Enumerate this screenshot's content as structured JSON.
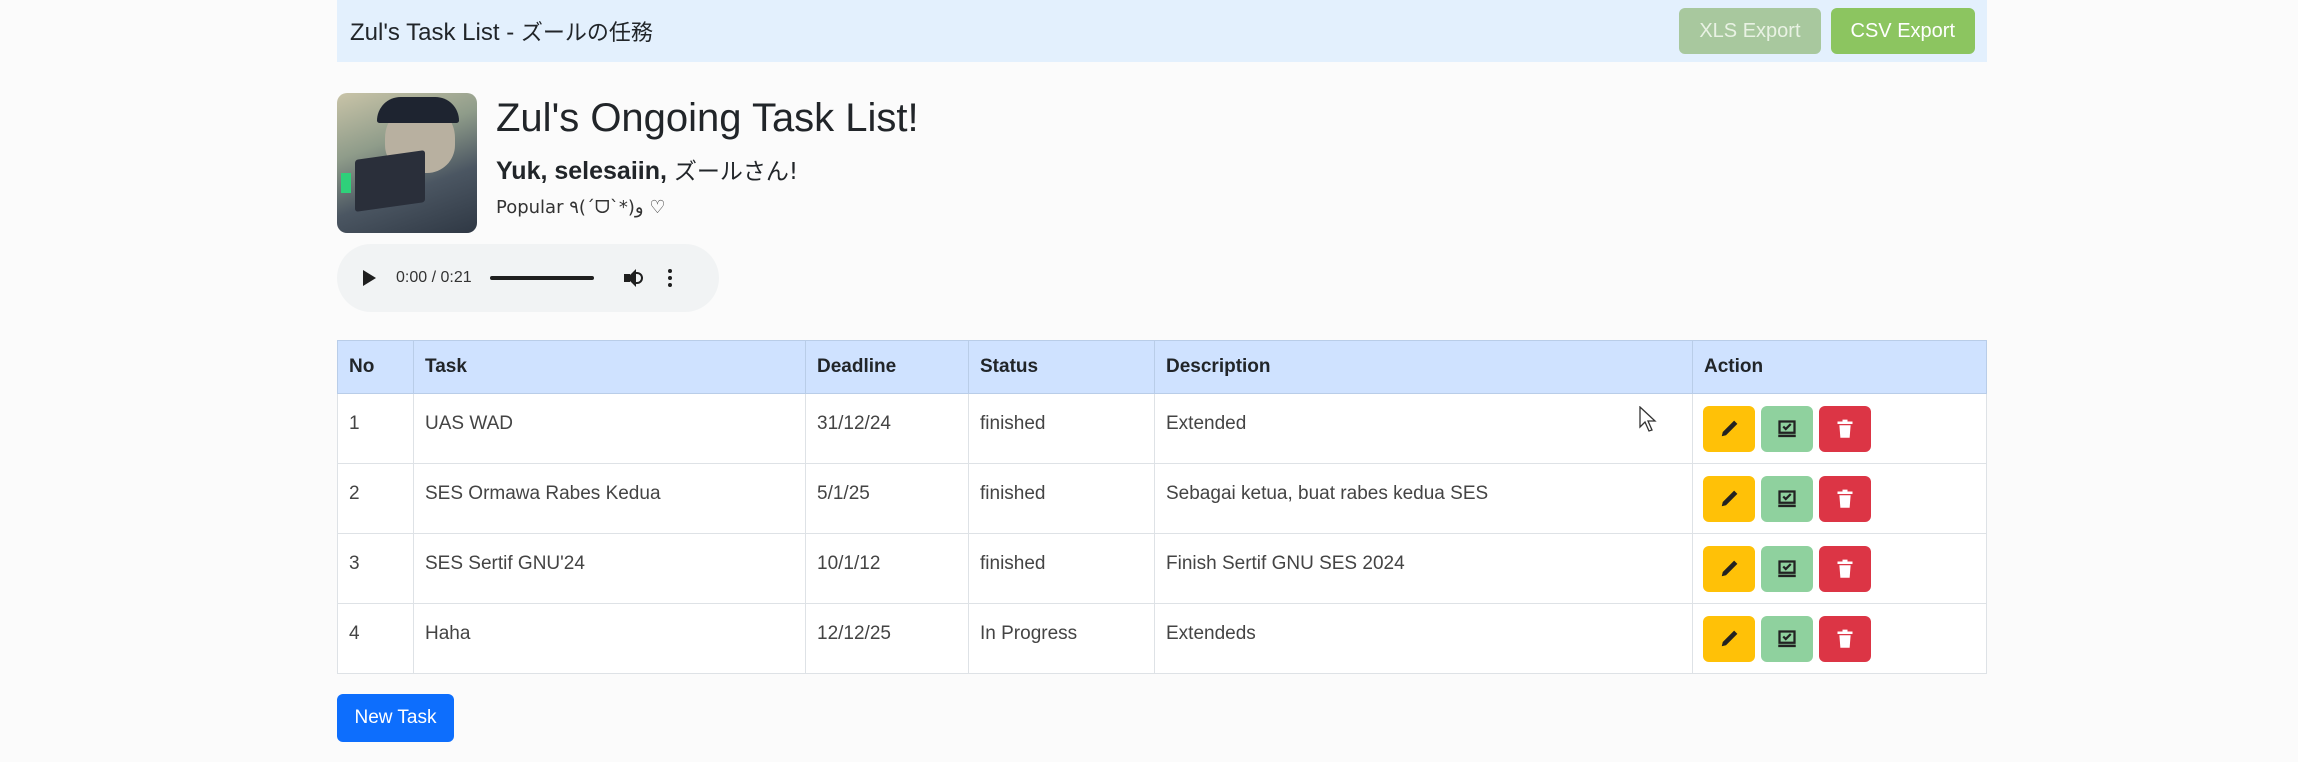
{
  "navbar": {
    "brand": "Zul's Task List - ",
    "brand_jp": "ズールの任務",
    "xls_export": "XLS Export",
    "csv_export": "CSV Export"
  },
  "header": {
    "title": "Zul's Ongoing Task List!",
    "subtitle": "Yuk, selesaiin, ",
    "subtitle_jp": "ズールさん!",
    "popular": "Popular ٩(ˊᗜˋ*)و ♡"
  },
  "audio": {
    "time": "0:00 / 0:21"
  },
  "table": {
    "headers": [
      "No",
      "Task",
      "Deadline",
      "Status",
      "Description",
      "Action"
    ],
    "rows": [
      {
        "no": "1",
        "task": "UAS WAD",
        "deadline": "31/12/24",
        "status": "finished",
        "description": "Extended"
      },
      {
        "no": "2",
        "task": "SES Ormawa Rabes Kedua",
        "deadline": "5/1/25",
        "status": "finished",
        "description": "Sebagai ketua, buat rabes kedua SES"
      },
      {
        "no": "3",
        "task": "SES Sertif GNU'24",
        "deadline": "10/1/12",
        "status": "finished",
        "description": "Finish Sertif GNU SES 2024"
      },
      {
        "no": "4",
        "task": "Haha",
        "deadline": "12/12/25",
        "status": "In Progress",
        "description": "Extendeds"
      }
    ]
  },
  "new_task_label": "New Task",
  "colors": {
    "navbar_bg": "#e3f0fd",
    "table_header_bg": "#cfe2ff",
    "edit": "#ffc107",
    "complete": "#8fd19e",
    "delete": "#dc3545",
    "primary": "#0d6efd"
  },
  "icons": {
    "edit": "pencil-icon",
    "complete": "check-box-icon",
    "delete": "trash-icon"
  }
}
